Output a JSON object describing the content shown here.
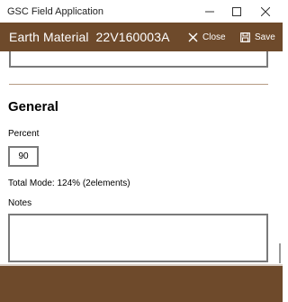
{
  "window": {
    "title": "GSC Field Application"
  },
  "header": {
    "title": "Earth Material",
    "record_id": "22V160003A",
    "close_label": "Close",
    "save_label": "Save"
  },
  "section": {
    "title": "General"
  },
  "percent": {
    "label": "Percent",
    "value": "90"
  },
  "total_mode_text": "Total Mode: 124% (2elements)",
  "notes": {
    "label": "Notes",
    "value": ""
  },
  "colors": {
    "header_bg": "#6e4a2b",
    "divider": "#b79b84"
  }
}
